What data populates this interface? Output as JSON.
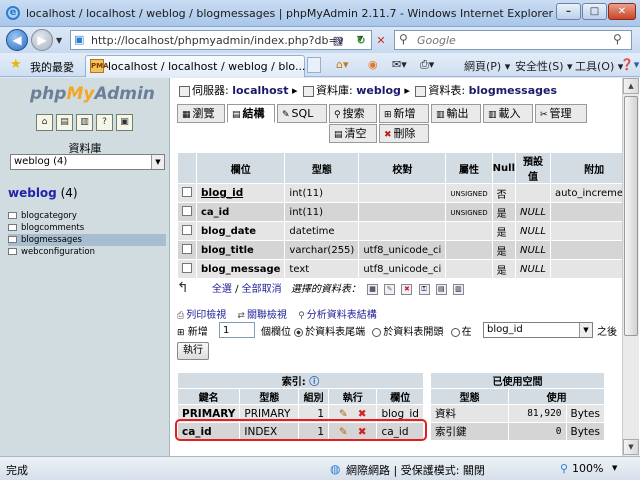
{
  "window": {
    "title": "localhost / localhost / weblog / blogmessages | phpMyAdmin 2.11.7 - Windows Internet Explorer",
    "minimize": "–",
    "maximize": "□",
    "close": "✕"
  },
  "browser": {
    "address": "http://localhost/phpmyadmin/index.php?db=we",
    "search_placeholder": "Google",
    "favorites_label": "我的最愛",
    "tab_title": "localhost / localhost / weblog / blo...",
    "commands": {
      "page": "網頁(P) ▾",
      "safety": "安全性(S) ▾",
      "tools": "工具(O) ▾",
      "help": "❓▾"
    }
  },
  "sidebar": {
    "logo_php": "php",
    "logo_my": "My",
    "logo_admin": "Admin",
    "db_label": "資料庫",
    "db_selected": "weblog (4)",
    "db_name": "weblog",
    "db_count": "(4)",
    "tables": [
      "blogcategory",
      "blogcomments",
      "blogmessages",
      "webconfiguration"
    ],
    "active_table": "blogmessages"
  },
  "breadcrumb": {
    "server_label": "伺服器:",
    "server": "localhost",
    "db_label": "資料庫:",
    "db": "weblog",
    "table_label": "資料表:",
    "table": "blogmessages"
  },
  "tabs": [
    {
      "label": "瀏覽",
      "icon": "▦",
      "active": false
    },
    {
      "label": "結構",
      "icon": "▤",
      "active": true
    },
    {
      "label": "SQL",
      "icon": "✎",
      "active": false
    },
    {
      "label": "搜索",
      "icon": "⚲",
      "active": false
    },
    {
      "label": "新增",
      "icon": "⊞",
      "active": false
    },
    {
      "label": "輸出",
      "icon": "▥",
      "active": false
    },
    {
      "label": "載入",
      "icon": "▥",
      "active": false
    },
    {
      "label": "管理",
      "icon": "✂",
      "active": false
    },
    {
      "label": "清空",
      "icon": "▤",
      "active": false
    },
    {
      "label": "刪除",
      "icon": "✖",
      "active": false
    }
  ],
  "structure": {
    "headers": {
      "field": "欄位",
      "type": "型態",
      "collation": "校對",
      "attributes": "屬性",
      "null": "Null",
      "default_1": "預設",
      "default_2": "值",
      "extra": "附加"
    },
    "rows": [
      {
        "field": "blog_id",
        "type": "int(11)",
        "collation": "",
        "attributes": "UNSIGNED",
        "null": "否",
        "default": "",
        "extra": "auto_increment",
        "underline": true
      },
      {
        "field": "ca_id",
        "type": "int(11)",
        "collation": "",
        "attributes": "UNSIGNED",
        "null": "是",
        "default": "NULL",
        "extra": "",
        "underline": false
      },
      {
        "field": "blog_date",
        "type": "datetime",
        "collation": "",
        "attributes": "",
        "null": "是",
        "default": "NULL",
        "extra": "",
        "underline": false
      },
      {
        "field": "blog_title",
        "type": "varchar(255)",
        "collation": "utf8_unicode_ci",
        "attributes": "",
        "null": "是",
        "default": "NULL",
        "extra": "",
        "underline": false
      },
      {
        "field": "blog_message",
        "type": "text",
        "collation": "utf8_unicode_ci",
        "attributes": "",
        "null": "是",
        "default": "NULL",
        "extra": "",
        "underline": false
      }
    ]
  },
  "selection": {
    "check_all": "全選",
    "separator": " / ",
    "uncheck_all": "全部取消",
    "with_selected": "選擇的資料表："
  },
  "tools": {
    "print": "列印檢視",
    "relation": "關聯檢視",
    "propose": "分析資料表結構"
  },
  "add_field": {
    "label": "新增",
    "count": "1",
    "unit": "個欄位",
    "opt_end": "於資料表尾端",
    "opt_begin": "於資料表開頭",
    "opt_after": "在",
    "after_field": "blog_id",
    "after_suffix": "之後",
    "go": "執行"
  },
  "indexes": {
    "title": "索引:",
    "headers": {
      "keyname": "鍵名",
      "type": "型態",
      "cardinality": "組別",
      "action": "執行",
      "field": "欄位"
    },
    "rows": [
      {
        "keyname": "PRIMARY",
        "type": "PRIMARY",
        "cardinality": "1",
        "field": "blog_id"
      },
      {
        "keyname": "ca_id",
        "type": "INDEX",
        "cardinality": "1",
        "field": "ca_id"
      }
    ]
  },
  "space": {
    "title": "已使用空間",
    "headers": {
      "type": "型態",
      "usage": "使用"
    },
    "rows": [
      {
        "type": "資料",
        "value": "81,920",
        "unit": "Bytes"
      },
      {
        "type": "索引鍵",
        "value": "0",
        "unit": "Bytes"
      }
    ]
  },
  "status": {
    "text": "完成",
    "zone": "網際網路 | 受保護模式: 關閉",
    "zoom": "100%"
  }
}
